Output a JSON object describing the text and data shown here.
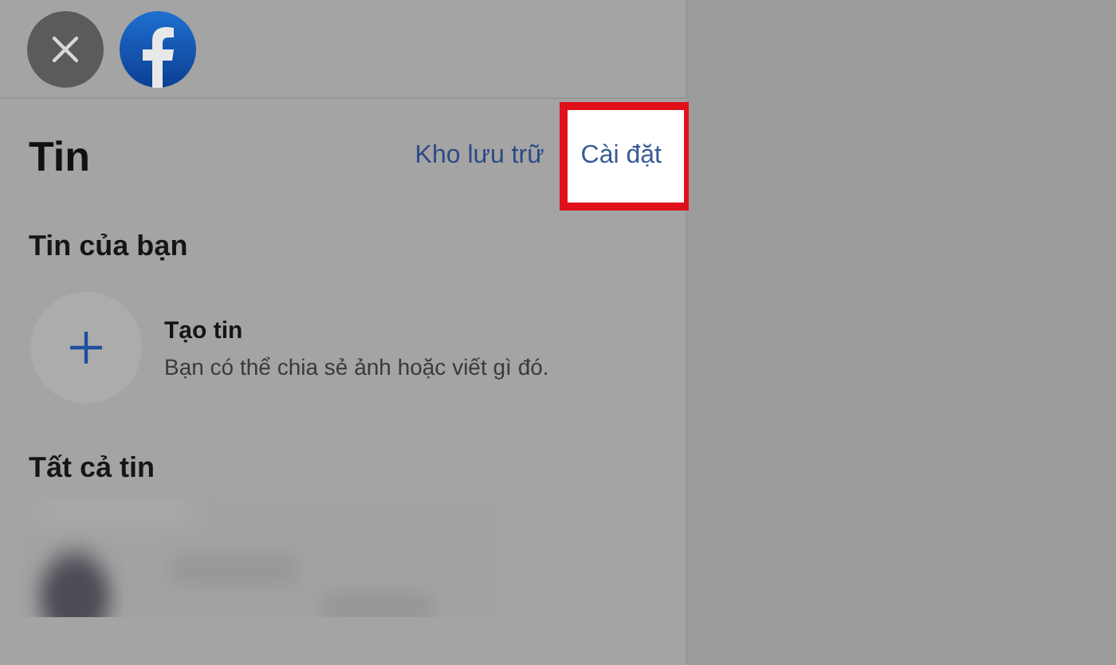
{
  "header": {
    "title": "Tin",
    "links": [
      {
        "label": "Kho lưu trữ",
        "highlighted": false
      },
      {
        "label": "Cài đặt",
        "highlighted": true
      }
    ]
  },
  "your_story": {
    "heading": "Tin của bạn",
    "create": {
      "title": "Tạo tin",
      "subtitle": "Bạn có thể chia sẻ ảnh hoặc viết gì đó."
    }
  },
  "all_stories": {
    "heading": "Tất cả tin"
  }
}
